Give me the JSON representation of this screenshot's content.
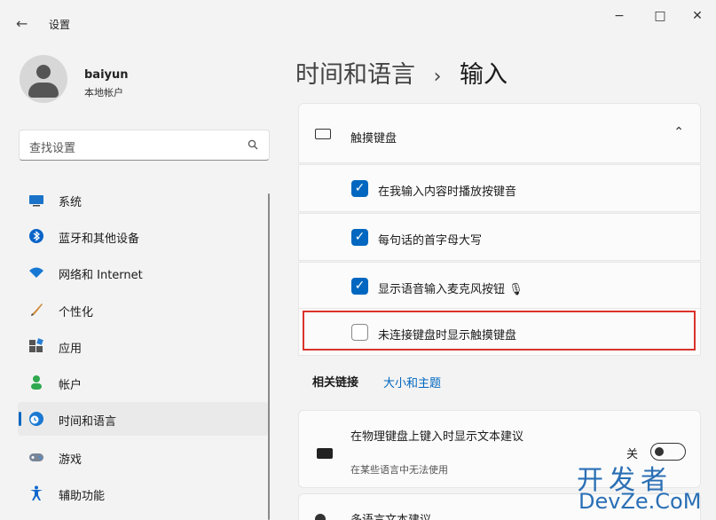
{
  "window": {
    "back": "←",
    "title": "设置",
    "minimize": "−",
    "maximize": "□",
    "close": "✕"
  },
  "user": {
    "name": "baiyun",
    "type": "本地帐户"
  },
  "search": {
    "placeholder": "查找设置"
  },
  "nav": [
    {
      "label": "系统",
      "icon": "monitor-icon"
    },
    {
      "label": "蓝牙和其他设备",
      "icon": "bluetooth-icon"
    },
    {
      "label": "网络和 Internet",
      "icon": "wifi-icon"
    },
    {
      "label": "个性化",
      "icon": "brush-icon"
    },
    {
      "label": "应用",
      "icon": "apps-icon"
    },
    {
      "label": "帐户",
      "icon": "person-icon"
    },
    {
      "label": "时间和语言",
      "icon": "globe-clock-icon",
      "selected": true
    },
    {
      "label": "游戏",
      "icon": "gamepad-icon"
    },
    {
      "label": "辅助功能",
      "icon": "accessibility-icon"
    }
  ],
  "breadcrumb": {
    "parent": "时间和语言",
    "sep": "›",
    "current": "输入"
  },
  "touch_keyboard": {
    "title": "触摸键盘",
    "options": [
      {
        "label": "在我输入内容时播放按键音",
        "checked": true
      },
      {
        "label": "每句话的首字母大写",
        "checked": true
      },
      {
        "label": "显示语音输入麦克风按钮 🎙",
        "checked": true
      },
      {
        "label": "未连接键盘时显示触摸键盘",
        "checked": false
      }
    ]
  },
  "related": {
    "label": "相关链接",
    "link": "大小和主题"
  },
  "text_suggestions": {
    "title": "在物理键盘上键入时显示文本建议",
    "note": "在某些语言中无法使用",
    "state": "关"
  },
  "multilang": {
    "title": "多语言文本建议"
  },
  "watermark": {
    "line1": "开发者",
    "line2": "DevZe.CoM"
  },
  "colors": {
    "accent": "#0067c0",
    "highlight": "#d9332b"
  }
}
